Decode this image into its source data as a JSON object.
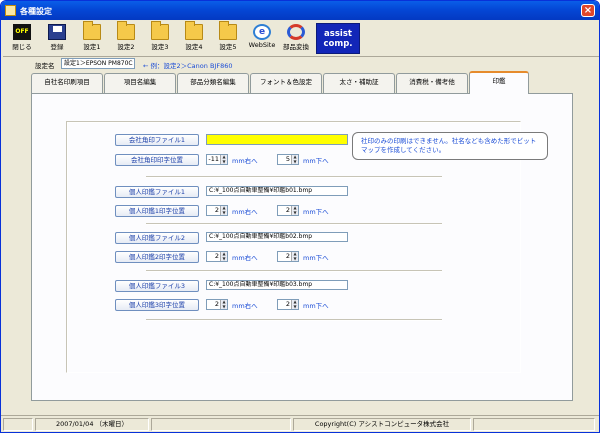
{
  "window": {
    "title": "各種設定"
  },
  "toolbar": {
    "close": "閉じる",
    "save": "登録",
    "settings": [
      "設定1",
      "設定2",
      "設定3",
      "設定4",
      "設定5"
    ],
    "website": "WebSite",
    "parts_convert": "部品変換",
    "assist": "assist\ncomp."
  },
  "setting": {
    "label": "設定名",
    "value": "設定1＞EPSON PM870C",
    "hint": "← 例：設定2＞Canon BJF860"
  },
  "tabs": [
    "自社名印刷項目",
    "項目名編集",
    "部品分類名編集",
    "フォント＆色設定",
    "太さ・補助証",
    "消費税・備考他",
    "印鑑"
  ],
  "form": {
    "company_seal_file_label": "会社角印ファイル1",
    "company_seal_file_value": "",
    "company_seal_pos_label": "会社角印印字位置",
    "company_seal_x": "-11",
    "company_seal_y": "5",
    "unit_right": "mm右へ",
    "unit_down": "mm下へ",
    "personal": [
      {
        "file_label": "個人印鑑ファイル1",
        "file_value": "C:¥_100点自動車整備¥印鑑b01.bmp",
        "pos_label": "個人印鑑1印字位置",
        "x": "2",
        "y": "2"
      },
      {
        "file_label": "個人印鑑ファイル2",
        "file_value": "C:¥_100点自動車整備¥印鑑b02.bmp",
        "pos_label": "個人印鑑2印字位置",
        "x": "2",
        "y": "2"
      },
      {
        "file_label": "個人印鑑ファイル3",
        "file_value": "C:¥_100点自動車整備¥印鑑b03.bmp",
        "pos_label": "個人印鑑3印字位置",
        "x": "2",
        "y": "2"
      }
    ],
    "note": "社印のみの印刷はできません。社名なども含めた形でビットマップを作成してください。"
  },
  "status": {
    "date": "2007/01/04 （木曜日）",
    "copyright": "Copyright(C) アシストコンピュータ株式会社"
  },
  "colors": {
    "title_bar": "#0447d6",
    "yellow_field": "#ffff00",
    "assist_logo": "#1226b8",
    "blue_text": "#1a4cd6"
  }
}
